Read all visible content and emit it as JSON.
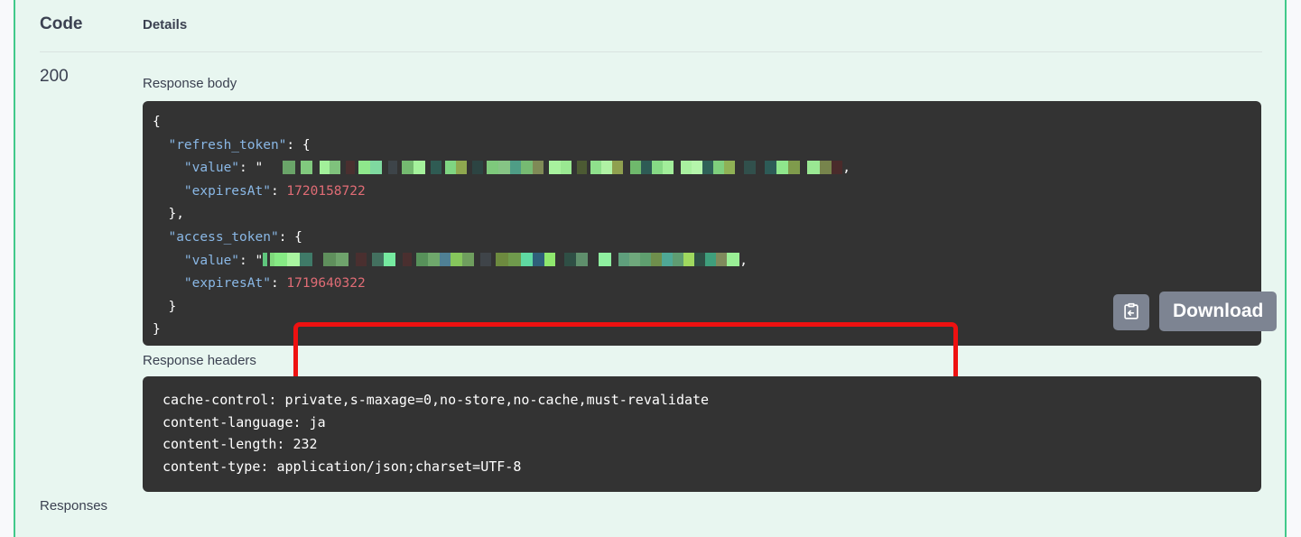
{
  "table": {
    "code_header": "Code",
    "details_header": "Details"
  },
  "response": {
    "status_code": "200",
    "body_label": "Response body",
    "headers_label": "Response headers",
    "responses_label": "Responses"
  },
  "body_json": {
    "line_open": "{",
    "refresh_token_key": "\"refresh_token\"",
    "access_token_key": "\"access_token\"",
    "value_key": "\"value\"",
    "expires_key": "\"expiresAt\"",
    "refresh_expires_value": "1720158722",
    "access_expires_value": "1719640322",
    "redacted_note": "redacted token value",
    "brace_open": "{",
    "brace_close": "}",
    "brace_close_comma": "},",
    "colon": ": ",
    "quote": "\"",
    "comma": ",",
    "line_close": "}"
  },
  "headers": [
    {
      "name": "cache-control:",
      "value": "private,s-maxage=0,no-store,no-cache,must-revalidate"
    },
    {
      "name": "content-language:",
      "value": "ja"
    },
    {
      "name": "content-length:",
      "value": "232"
    },
    {
      "name": "content-type:",
      "value": "application/json;charset=UTF-8"
    }
  ],
  "actions": {
    "copy_icon": "copy-to-clipboard-icon",
    "download_label": "Download"
  },
  "colors": {
    "accent_green": "#41c98a",
    "panel_bg": "#333333",
    "page_bg": "#e8f6f0",
    "highlight_red": "#ee1111",
    "key_blue": "#8ab8e6",
    "number_red": "#e06c75",
    "button_gray": "#7d8492"
  },
  "redaction_swatches": {
    "refresh_value": [
      [
        22,
        "#333333"
      ],
      [
        14,
        "#6aa469"
      ],
      [
        6,
        "#333333"
      ],
      [
        13,
        "#81c97e"
      ],
      [
        8,
        "#333333"
      ],
      [
        11,
        "#a2f09a"
      ],
      [
        12,
        "#7fc27c"
      ],
      [
        6,
        "#333333"
      ],
      [
        10,
        "#4a2f2f"
      ],
      [
        4,
        "#333333"
      ],
      [
        13,
        "#8fe88c"
      ],
      [
        13,
        "#7fd9a0"
      ],
      [
        7,
        "#333333"
      ],
      [
        10,
        "#3d4449"
      ],
      [
        5,
        "#333333"
      ],
      [
        13,
        "#74ba70"
      ],
      [
        13,
        "#a5f29c"
      ],
      [
        6,
        "#333333"
      ],
      [
        12,
        "#2f5b53"
      ],
      [
        4,
        "#333333"
      ],
      [
        12,
        "#7fd582"
      ],
      [
        12,
        "#8fa84f"
      ],
      [
        6,
        "#333333"
      ],
      [
        12,
        "#2c4442"
      ],
      [
        4,
        "#333333"
      ],
      [
        13,
        "#7ec97c"
      ],
      [
        13,
        "#86c485"
      ],
      [
        12,
        "#4f9d86"
      ],
      [
        13,
        "#76ba72"
      ],
      [
        12,
        "#7f8a56"
      ],
      [
        6,
        "#333333"
      ],
      [
        13,
        "#a8f29e"
      ],
      [
        12,
        "#9ae892"
      ],
      [
        6,
        "#333333"
      ],
      [
        11,
        "#4c5a33"
      ],
      [
        4,
        "#333333"
      ],
      [
        12,
        "#8fe08c"
      ],
      [
        12,
        "#b0f2a4"
      ],
      [
        12,
        "#8fa04f"
      ],
      [
        8,
        "#333333"
      ],
      [
        12,
        "#6fb86c"
      ],
      [
        12,
        "#2e5b55"
      ],
      [
        12,
        "#86d985"
      ],
      [
        12,
        "#a2ee9a"
      ],
      [
        8,
        "#333333"
      ],
      [
        12,
        "#a9f0a0"
      ],
      [
        12,
        "#b5f5ab"
      ],
      [
        12,
        "#2f6158"
      ],
      [
        12,
        "#7fcf7d"
      ],
      [
        12,
        "#8fb155"
      ],
      [
        10,
        "#333333"
      ],
      [
        13,
        "#31504c"
      ],
      [
        10,
        "#333333"
      ],
      [
        13,
        "#2d5b57"
      ],
      [
        13,
        "#8fe68c"
      ],
      [
        13,
        "#7f9b4c"
      ],
      [
        8,
        "#333333"
      ],
      [
        14,
        "#9ae893"
      ],
      [
        13,
        "#77844c"
      ],
      [
        12,
        "#4a2b2b"
      ]
    ],
    "access_value": [
      [
        5,
        "#5fc67d"
      ],
      [
        3,
        "#333333"
      ],
      [
        5,
        "#7fd97c"
      ],
      [
        14,
        "#86ea84"
      ],
      [
        14,
        "#a9f5a0"
      ],
      [
        14,
        "#3f7a68"
      ],
      [
        12,
        "#333333"
      ],
      [
        14,
        "#5f8f5c"
      ],
      [
        14,
        "#6fa36c"
      ],
      [
        8,
        "#333333"
      ],
      [
        12,
        "#4a2f2f"
      ],
      [
        6,
        "#333333"
      ],
      [
        13,
        "#43705f"
      ],
      [
        13,
        "#76eaa0"
      ],
      [
        8,
        "#333333"
      ],
      [
        10,
        "#4a2f2f"
      ],
      [
        5,
        "#333333"
      ],
      [
        13,
        "#57915a"
      ],
      [
        13,
        "#6fa86c"
      ],
      [
        12,
        "#4f8094"
      ],
      [
        13,
        "#86c65c"
      ],
      [
        13,
        "#6f9e5e"
      ],
      [
        7,
        "#333333"
      ],
      [
        12,
        "#3f4449"
      ],
      [
        5,
        "#333333"
      ],
      [
        14,
        "#6d8a3f"
      ],
      [
        14,
        "#6f9a4c"
      ],
      [
        13,
        "#5fd9a2"
      ],
      [
        13,
        "#2f5f7a"
      ],
      [
        12,
        "#8fe86e"
      ],
      [
        10,
        "#333333"
      ],
      [
        13,
        "#2f4f45"
      ],
      [
        13,
        "#5f8f6c"
      ],
      [
        12,
        "#333333"
      ],
      [
        14,
        "#8fefa0"
      ],
      [
        8,
        "#333333"
      ],
      [
        12,
        "#5f9f7c"
      ],
      [
        12,
        "#6fa87c"
      ],
      [
        12,
        "#5f9f6f"
      ],
      [
        12,
        "#6f8f4c"
      ],
      [
        12,
        "#4fa896"
      ],
      [
        12,
        "#5f9d72"
      ],
      [
        12,
        "#9fd95f"
      ],
      [
        12,
        "#2f4f45"
      ],
      [
        12,
        "#3f9f7c"
      ],
      [
        12,
        "#7f8a5c"
      ],
      [
        14,
        "#9aef96"
      ]
    ]
  }
}
